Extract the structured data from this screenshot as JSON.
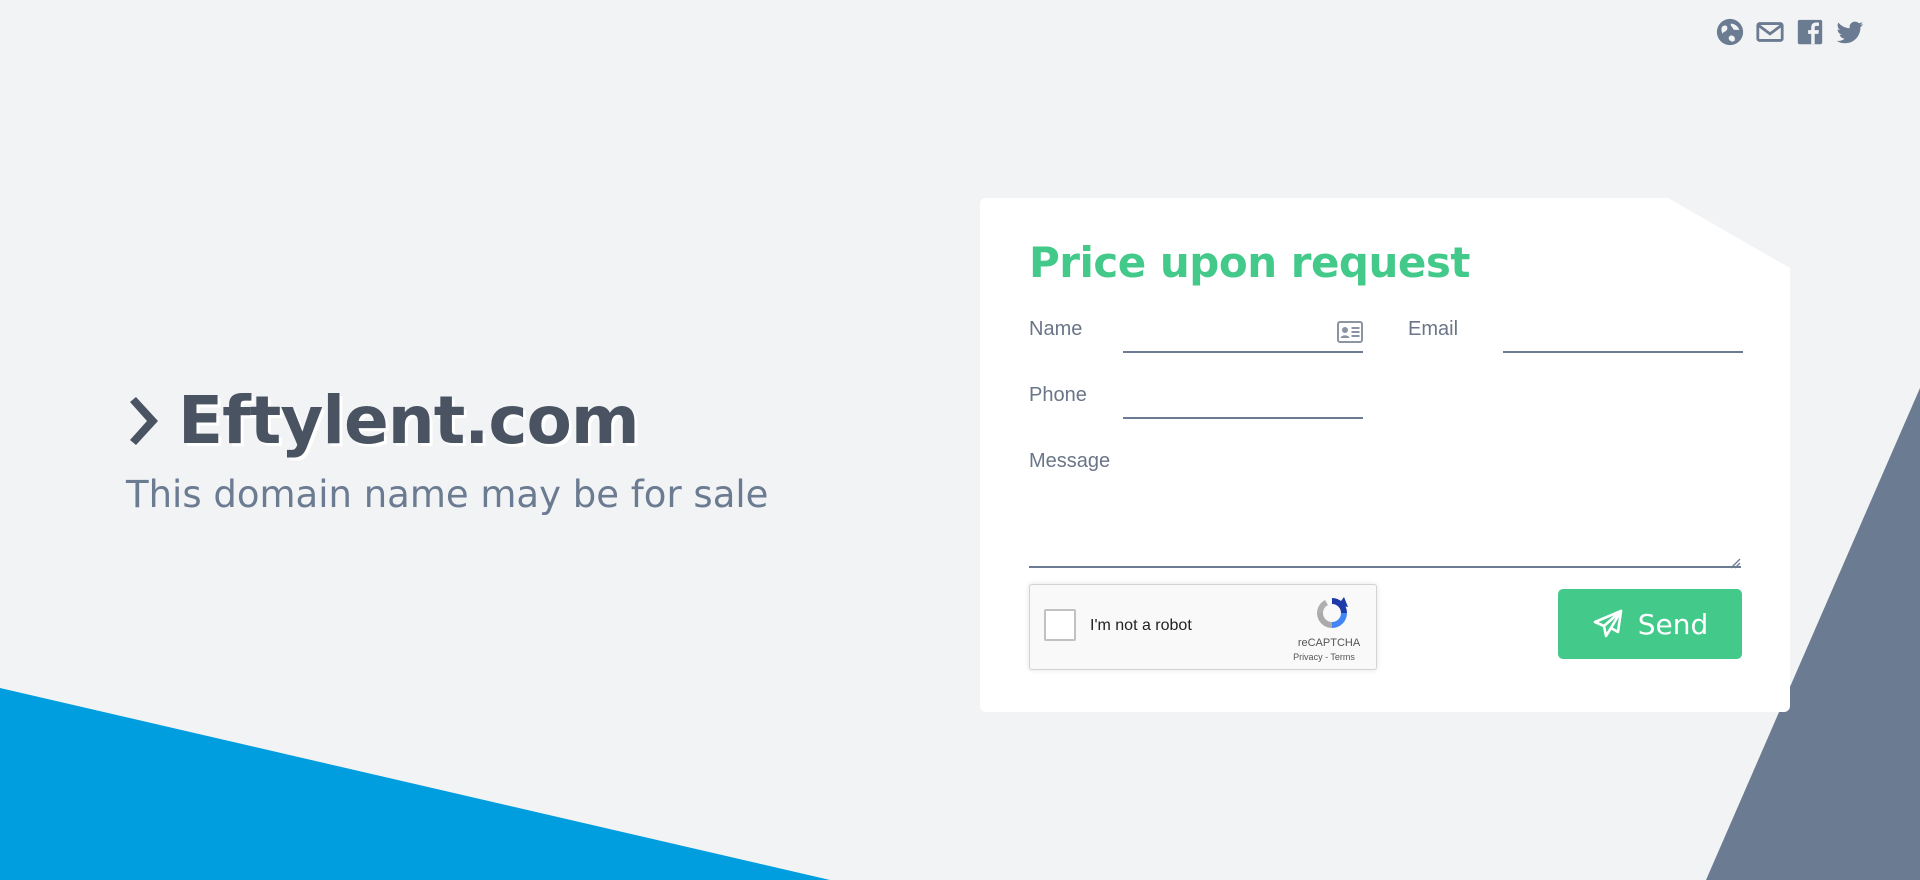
{
  "colors": {
    "background": "#f2f3f5",
    "accent_green": "#43c98a",
    "blue_shape": "#009ddf",
    "slate_shape": "#6b7b91",
    "title_text": "#4a5361"
  },
  "social": {
    "icons": [
      "globe-icon",
      "mail-icon",
      "facebook-icon",
      "twitter-icon"
    ]
  },
  "hero": {
    "domain": "Eftylent.com",
    "subtitle": "This domain name may be for sale"
  },
  "form": {
    "title": "Price upon request",
    "name_label": "Name",
    "email_label": "Email",
    "phone_label": "Phone",
    "message_label": "Message",
    "name_value": "",
    "email_value": "",
    "phone_value": "",
    "message_value": "",
    "send_label": "Send"
  },
  "recaptcha": {
    "label": "I'm not a robot",
    "brand": "reCAPTCHA",
    "privacy": "Privacy",
    "separator": " - ",
    "terms": "Terms"
  }
}
